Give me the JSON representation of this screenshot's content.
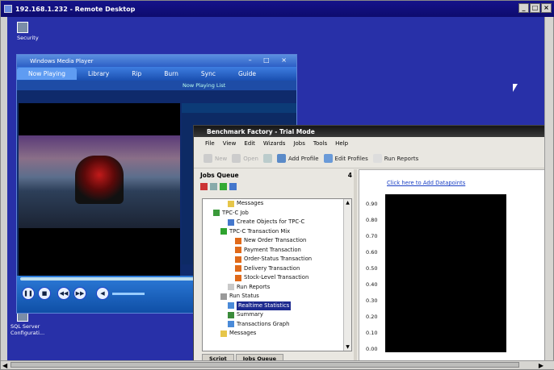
{
  "window": {
    "title": "192.168.1.232 - Remote Desktop",
    "min": "_",
    "max": "□",
    "close": "×"
  },
  "desktop_icons": [
    {
      "label": "Security",
      "icon": "security-icon"
    },
    {
      "label": "SQL Server\nConfigurati...",
      "icon": "sql-server-config-icon"
    }
  ],
  "wmp": {
    "title": "Windows Media Player",
    "tabs": [
      "Now Playing",
      "Library",
      "Rip",
      "Burn",
      "Sync",
      "Guide"
    ],
    "playlist_header": "Now Playing List"
  },
  "bf": {
    "title": "Benchmark Factory - Trial Mode",
    "menu": [
      "File",
      "View",
      "Edit",
      "Wizards",
      "Jobs",
      "Tools",
      "Help"
    ],
    "toolbar": {
      "new": "New",
      "open": "Open",
      "add_profile": "Add Profile",
      "edit_profiles": "Edit Profiles",
      "run_reports": "Run Reports"
    },
    "jobs_queue": "Jobs Queue",
    "pin": "4",
    "tree": [
      {
        "label": "Messages",
        "indent": 3,
        "icon": "messages-icon",
        "color": "#e6c64a"
      },
      {
        "label": "TPC-C Job",
        "indent": 1,
        "icon": "job-icon",
        "color": "#3a9a3a"
      },
      {
        "label": "Create Objects for TPC-C",
        "indent": 3,
        "icon": "create-objects-icon",
        "color": "#4477cc"
      },
      {
        "label": "TPC-C Transaction Mix",
        "indent": 2,
        "icon": "transaction-mix-icon",
        "color": "#2fa32f"
      },
      {
        "label": "New Order Transaction",
        "indent": 4,
        "icon": "transaction-icon",
        "color": "#e06a1a"
      },
      {
        "label": "Payment Transaction",
        "indent": 4,
        "icon": "transaction-icon",
        "color": "#e06a1a"
      },
      {
        "label": "Order-Status Transaction",
        "indent": 4,
        "icon": "transaction-icon",
        "color": "#e06a1a"
      },
      {
        "label": "Delivery Transaction",
        "indent": 4,
        "icon": "transaction-icon",
        "color": "#e06a1a"
      },
      {
        "label": "Stock-Level Transaction",
        "indent": 4,
        "icon": "transaction-icon",
        "color": "#e06a1a"
      },
      {
        "label": "Run Reports",
        "indent": 3,
        "icon": "run-reports-icon",
        "color": "#c9c9c9"
      },
      {
        "label": "Run Status",
        "indent": 2,
        "icon": "run-status-icon",
        "color": "#9a9a9a"
      },
      {
        "label": "Realtime Statistics",
        "indent": 3,
        "icon": "realtime-stats-icon",
        "color": "#4a8ad8",
        "selected": true
      },
      {
        "label": "Summary",
        "indent": 3,
        "icon": "summary-icon",
        "color": "#3a8a3a"
      },
      {
        "label": "Transactions Graph",
        "indent": 3,
        "icon": "transactions-graph-icon",
        "color": "#4a8ad8"
      },
      {
        "label": "Messages",
        "indent": 2,
        "icon": "messages-icon",
        "color": "#e6c64a"
      }
    ],
    "bottom_tabs": [
      "Script",
      "Jobs Queue"
    ],
    "datapoints_link": "Click here to Add Datapoints",
    "yticks": [
      "0.90",
      "0.80",
      "0.70",
      "0.60",
      "0.50",
      "0.40",
      "0.30",
      "0.20",
      "0.10",
      "0.00"
    ]
  }
}
